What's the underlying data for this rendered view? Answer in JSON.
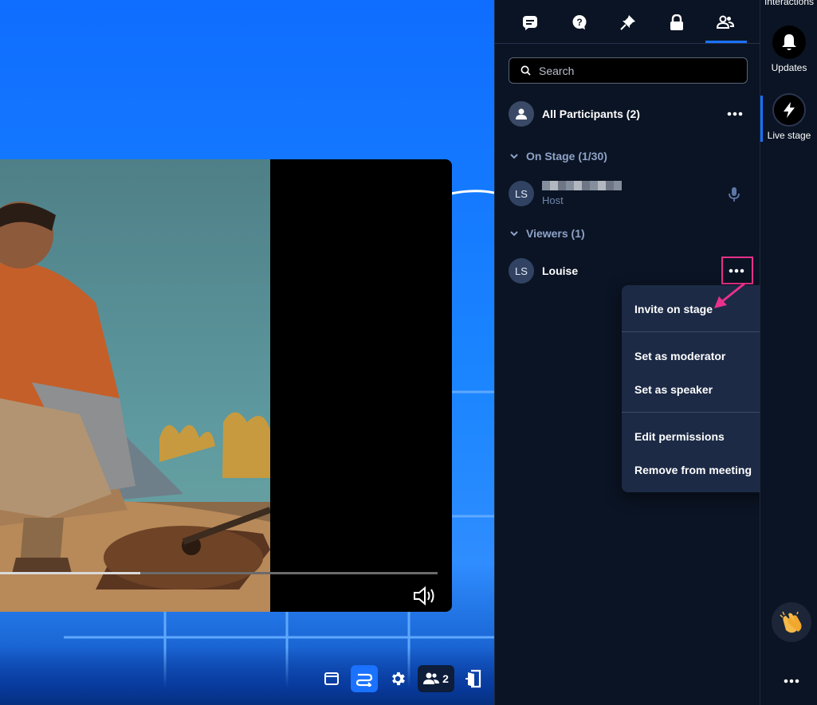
{
  "stage": {
    "video_progress": 0.32,
    "participants_count": "2"
  },
  "panel": {
    "tabs": [
      {
        "icon": "chat-icon"
      },
      {
        "icon": "question-icon"
      },
      {
        "icon": "pin-icon"
      },
      {
        "icon": "lock-icon"
      },
      {
        "icon": "participants-icon",
        "active": true
      }
    ],
    "search_placeholder": "Search",
    "all_participants_label": "All Participants (2)",
    "on_stage_label": "On Stage (1/30)",
    "viewers_label": "Viewers (1)",
    "host": {
      "initials": "LS",
      "role": "Host"
    },
    "viewer": {
      "initials": "LS",
      "name": "Louise"
    }
  },
  "menu": {
    "invite": "Invite on stage",
    "set_moderator": "Set as moderator",
    "set_speaker": "Set as speaker",
    "edit_permissions": "Edit permissions",
    "remove": "Remove from meeting"
  },
  "rail": {
    "interactions_label": "Interactions",
    "updates_label": "Updates",
    "live_stage_label": "Live stage"
  },
  "colors": {
    "accent": "#1a72ff",
    "highlight": "#e8318a",
    "panel_bg": "#0b1424",
    "menu_bg": "#1c2a45"
  }
}
